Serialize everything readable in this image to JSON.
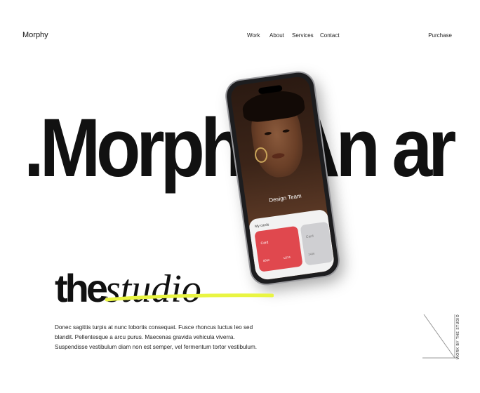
{
  "header": {
    "logo": "Morphy",
    "nav": [
      {
        "label": "Work"
      },
      {
        "label": "About"
      },
      {
        "label": "Services"
      },
      {
        "label": "Contact"
      }
    ],
    "purchase_label": "Purchase"
  },
  "hero": {
    "marquee_text": ".Morphy.An ar"
  },
  "phone": {
    "screen_title": "Design Team",
    "sheet_label": "My cards",
    "cards": [
      {
        "name": "Card",
        "number": "8584",
        "expiry": "12/24"
      },
      {
        "name": "Card",
        "number": "2436",
        "expiry": ""
      }
    ]
  },
  "studio": {
    "word_the": "the",
    "word_studio": "studio",
    "highlight_color": "#e9f542",
    "description": "Donec sagittis turpis at nunc lobortis consequat. Fusce rhoncus luctus leo sed blandit. Pellentesque a arcu purus. Maecenas gravida vehicula viverra. Suspendisse vestibulum diam non est semper, vel fermentum tortor vestibulum."
  },
  "side": {
    "vertical_label": "WORK BY THE STUDIO"
  },
  "colors": {
    "card_red": "#e0484e",
    "card_grey": "#cfcfd2",
    "text": "#111111"
  }
}
